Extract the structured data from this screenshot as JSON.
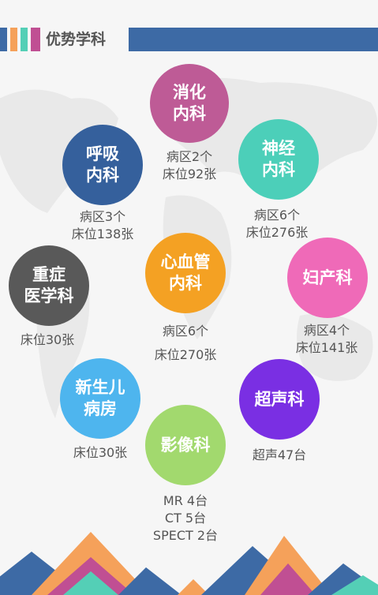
{
  "header": {
    "title": "优势学科"
  },
  "colors": {
    "header_bar": "#3d6aa5",
    "stripe_1": "#3d6aa5",
    "stripe_2": "#f5a15a",
    "stripe_3": "#54cfb6",
    "stripe_4": "#c04f93"
  },
  "departments": [
    {
      "id": "digestive",
      "name_lines": [
        "消化",
        "内科"
      ],
      "color": "#be5b96",
      "info": [
        "病区2个",
        "床位92张"
      ]
    },
    {
      "id": "neurology",
      "name_lines": [
        "神经",
        "内科"
      ],
      "color": "#4ccfb9",
      "info": [
        "病区6个",
        "床位276张"
      ]
    },
    {
      "id": "respiratory",
      "name_lines": [
        "呼吸",
        "内科"
      ],
      "color": "#35609c",
      "info": [
        "病区3个",
        "床位138张"
      ]
    },
    {
      "id": "cardiology",
      "name_lines": [
        "心血管",
        "内科"
      ],
      "color": "#f4a123",
      "info": [
        "病区6个",
        "床位270张"
      ]
    },
    {
      "id": "gynecology",
      "name_lines": [
        "妇产科"
      ],
      "color": "#ef6ab8",
      "info": [
        "病区4个",
        "床位141张"
      ]
    },
    {
      "id": "icu",
      "name_lines": [
        "重症",
        "医学科"
      ],
      "color": "#595959",
      "info": [
        "床位30张"
      ]
    },
    {
      "id": "ultrasound",
      "name_lines": [
        "超声科"
      ],
      "color": "#7a2fe3",
      "info": [
        "超声47台"
      ]
    },
    {
      "id": "neonatal",
      "name_lines": [
        "新生儿",
        "病房"
      ],
      "color": "#4eb5ee",
      "info": [
        "床位30张"
      ]
    },
    {
      "id": "imaging",
      "name_lines": [
        "影像科"
      ],
      "color": "#a2d96e",
      "info": [
        "MR 4台",
        "CT 5台",
        "SPECT 2台"
      ]
    }
  ]
}
